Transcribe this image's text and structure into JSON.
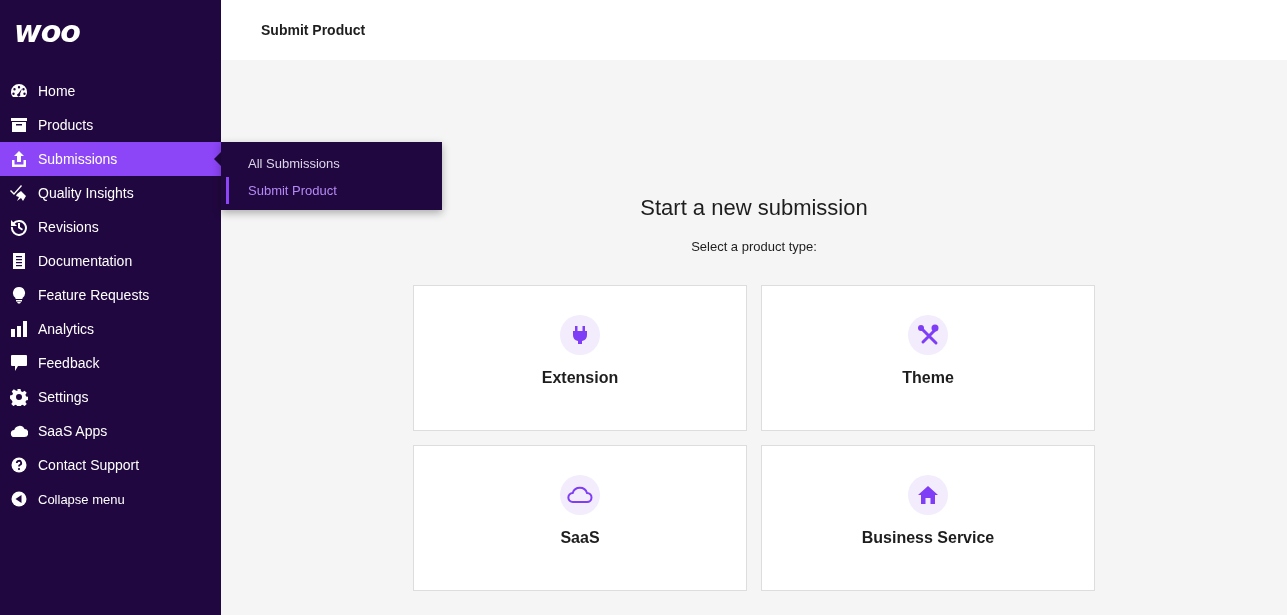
{
  "header": {
    "title": "Submit Product"
  },
  "sidebar": {
    "logo": "woo",
    "items": [
      {
        "label": "Home",
        "selected": false
      },
      {
        "label": "Products",
        "selected": false
      },
      {
        "label": "Submissions",
        "selected": true
      },
      {
        "label": "Quality Insights",
        "selected": false
      },
      {
        "label": "Revisions",
        "selected": false
      },
      {
        "label": "Documentation",
        "selected": false
      },
      {
        "label": "Feature Requests",
        "selected": false
      },
      {
        "label": "Analytics",
        "selected": false
      },
      {
        "label": "Feedback",
        "selected": false
      },
      {
        "label": "Settings",
        "selected": false
      },
      {
        "label": "SaaS Apps",
        "selected": false
      },
      {
        "label": "Contact Support",
        "selected": false
      }
    ],
    "collapse": "Collapse menu"
  },
  "submenu": {
    "items": [
      {
        "label": "All Submissions",
        "selected": false
      },
      {
        "label": "Submit Product",
        "selected": true
      }
    ]
  },
  "main": {
    "heading": "Start a new submission",
    "subheading": "Select a product type:",
    "cards": [
      {
        "label": "Extension"
      },
      {
        "label": "Theme"
      },
      {
        "label": "SaaS"
      },
      {
        "label": "Business Service"
      }
    ]
  }
}
